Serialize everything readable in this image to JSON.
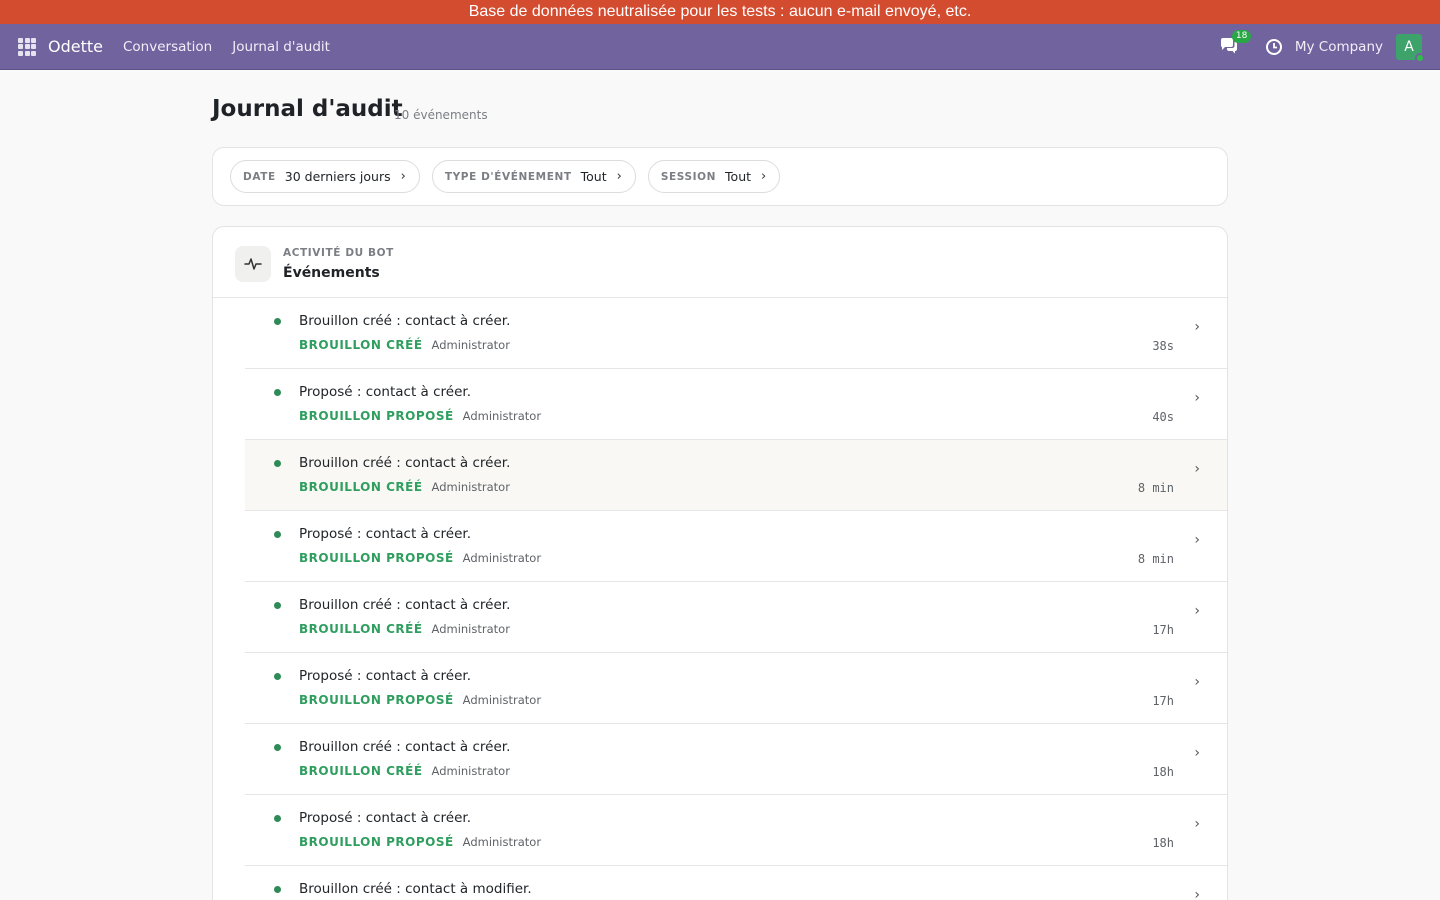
{
  "banner": {
    "text": "Base de données neutralisée pour les tests : aucun e-mail envoyé, etc."
  },
  "navbar": {
    "brand": "Odette",
    "links": [
      "Conversation",
      "Journal d'audit"
    ],
    "chat_badge": "18",
    "company": "My Company",
    "avatar_initial": "A"
  },
  "page": {
    "title": "Journal d'audit",
    "count": "10 événements"
  },
  "filters": [
    {
      "label": "DATE",
      "value": "30 derniers jours"
    },
    {
      "label": "TYPE D'ÉVÉNEMENT",
      "value": "Tout"
    },
    {
      "label": "SESSION",
      "value": "Tout"
    }
  ],
  "card": {
    "kicker": "ACTIVITÉ DU BOT",
    "title": "Événements"
  },
  "events": [
    {
      "text": "Brouillon créé : contact à créer.",
      "tag": "BROUILLON CRÉÉ",
      "user": "Administrator",
      "time": "38s"
    },
    {
      "text": "Proposé : contact à créer.",
      "tag": "BROUILLON PROPOSÉ",
      "user": "Administrator",
      "time": "40s"
    },
    {
      "text": "Brouillon créé : contact à créer.",
      "tag": "BROUILLON CRÉÉ",
      "user": "Administrator",
      "time": "8 min"
    },
    {
      "text": "Proposé : contact à créer.",
      "tag": "BROUILLON PROPOSÉ",
      "user": "Administrator",
      "time": "8 min"
    },
    {
      "text": "Brouillon créé : contact à créer.",
      "tag": "BROUILLON CRÉÉ",
      "user": "Administrator",
      "time": "17h"
    },
    {
      "text": "Proposé : contact à créer.",
      "tag": "BROUILLON PROPOSÉ",
      "user": "Administrator",
      "time": "17h"
    },
    {
      "text": "Brouillon créé : contact à créer.",
      "tag": "BROUILLON CRÉÉ",
      "user": "Administrator",
      "time": "18h"
    },
    {
      "text": "Proposé : contact à créer.",
      "tag": "BROUILLON PROPOSÉ",
      "user": "Administrator",
      "time": "18h"
    },
    {
      "text": "Brouillon créé : contact à modifier.",
      "tag": "",
      "user": "",
      "time": ""
    }
  ],
  "icons": {
    "apps": "apps-grid-icon",
    "chat": "chat-bubbles-icon",
    "clock": "clock-icon",
    "activity": "activity-pulse-icon",
    "chevron": "chevron-right-icon"
  },
  "colors": {
    "banner": "#d44c2f",
    "navbar": "#71639e",
    "tag_green": "#2f9e5f",
    "dot_green": "#2e8b57",
    "avatar": "#3ea36b"
  }
}
